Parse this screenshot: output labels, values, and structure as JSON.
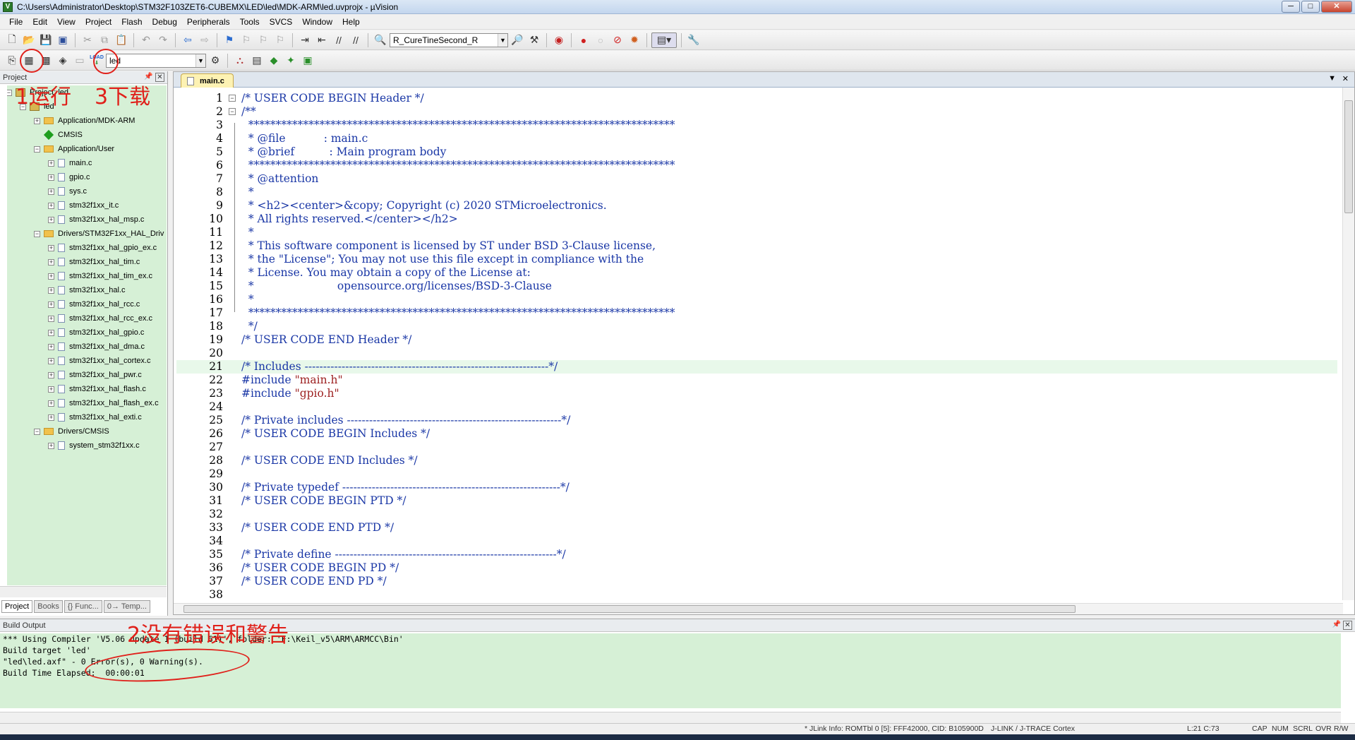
{
  "window": {
    "title": "C:\\Users\\Administrator\\Desktop\\STM32F103ZET6-CUBEMX\\LED\\led\\MDK-ARM\\led.uvprojx - µVision",
    "controls": {
      "minimize": "─",
      "maximize": "□",
      "close": "✕"
    }
  },
  "menu": [
    "File",
    "Edit",
    "View",
    "Project",
    "Flash",
    "Debug",
    "Peripherals",
    "Tools",
    "SVCS",
    "Window",
    "Help"
  ],
  "toolbar1": {
    "find_combo": "R_CureTineSecond_R"
  },
  "toolbar2": {
    "target_combo": "led",
    "load_label": "LOAD"
  },
  "project_pane": {
    "title": "Project",
    "root": "Project: led",
    "target": "led",
    "groups": [
      {
        "name": "Application/MDK-ARM",
        "files": []
      },
      {
        "name": "CMSIS",
        "files": []
      },
      {
        "name": "Application/User",
        "files": [
          "main.c",
          "gpio.c",
          "sys.c",
          "stm32f1xx_it.c",
          "stm32f1xx_hal_msp.c"
        ]
      },
      {
        "name": "Drivers/STM32F1xx_HAL_Driv",
        "files": [
          "stm32f1xx_hal_gpio_ex.c",
          "stm32f1xx_hal_tim.c",
          "stm32f1xx_hal_tim_ex.c",
          "stm32f1xx_hal.c",
          "stm32f1xx_hal_rcc.c",
          "stm32f1xx_hal_rcc_ex.c",
          "stm32f1xx_hal_gpio.c",
          "stm32f1xx_hal_dma.c",
          "stm32f1xx_hal_cortex.c",
          "stm32f1xx_hal_pwr.c",
          "stm32f1xx_hal_flash.c",
          "stm32f1xx_hal_flash_ex.c",
          "stm32f1xx_hal_exti.c"
        ]
      },
      {
        "name": "Drivers/CMSIS",
        "files": [
          "system_stm32f1xx.c"
        ]
      }
    ],
    "tabs": [
      "Project",
      "Books",
      "{} Func...",
      "0→ Temp..."
    ]
  },
  "editor": {
    "tab": "main.c",
    "lines": [
      "/* USER CODE BEGIN Header */",
      "/**",
      "  ******************************************************************************",
      "  * @file           : main.c",
      "  * @brief          : Main program body",
      "  ******************************************************************************",
      "  * @attention",
      "  *",
      "  * <h2><center>&copy; Copyright (c) 2020 STMicroelectronics.",
      "  * All rights reserved.</center></h2>",
      "  *",
      "  * This software component is licensed by ST under BSD 3-Clause license,",
      "  * the \"License\"; You may not use this file except in compliance with the",
      "  * License. You may obtain a copy of the License at:",
      "  *                        opensource.org/licenses/BSD-3-Clause",
      "  *",
      "  ******************************************************************************",
      "  */",
      "/* USER CODE END Header */",
      "",
      "/* Includes ------------------------------------------------------------------*/",
      "#include \"main.h\"",
      "#include \"gpio.h\"",
      "",
      "/* Private includes ----------------------------------------------------------*/",
      "/* USER CODE BEGIN Includes */",
      "",
      "/* USER CODE END Includes */",
      "",
      "/* Private typedef -----------------------------------------------------------*/",
      "/* USER CODE BEGIN PTD */",
      "",
      "/* USER CODE END PTD */",
      "",
      "/* Private define ------------------------------------------------------------*/",
      "/* USER CODE BEGIN PD */",
      "/* USER CODE END PD */",
      ""
    ],
    "highlighted_line": 21
  },
  "build_output": {
    "title": "Build Output",
    "lines": [
      "*** Using Compiler 'V5.06 update 1 (build 61)', folder: 'F:\\Keil_v5\\ARM\\ARMCC\\Bin'",
      "Build target 'led'",
      "\"led\\led.axf\" - 0 Error(s), 0 Warning(s).",
      "Build Time Elapsed:  00:00:01"
    ]
  },
  "status": {
    "debugger": "* JLink Info: ROMTbl 0 [5]: FFF42000, CID: B105900D",
    "adapter": "J-LINK / J-TRACE Cortex",
    "position": "L:21 C:73",
    "caps": "CAP",
    "num": "NUM",
    "scrl": "SCRL",
    "ovr": "OVR",
    "rw": "R/W"
  },
  "annotations": {
    "step1": "1运行",
    "step2": "2没有错误和警告",
    "step3": "3下载"
  },
  "colors": {
    "code_blue": "#1a37a6",
    "tree_bg": "#d6f0d6",
    "annotation_red": "#e0201a"
  }
}
